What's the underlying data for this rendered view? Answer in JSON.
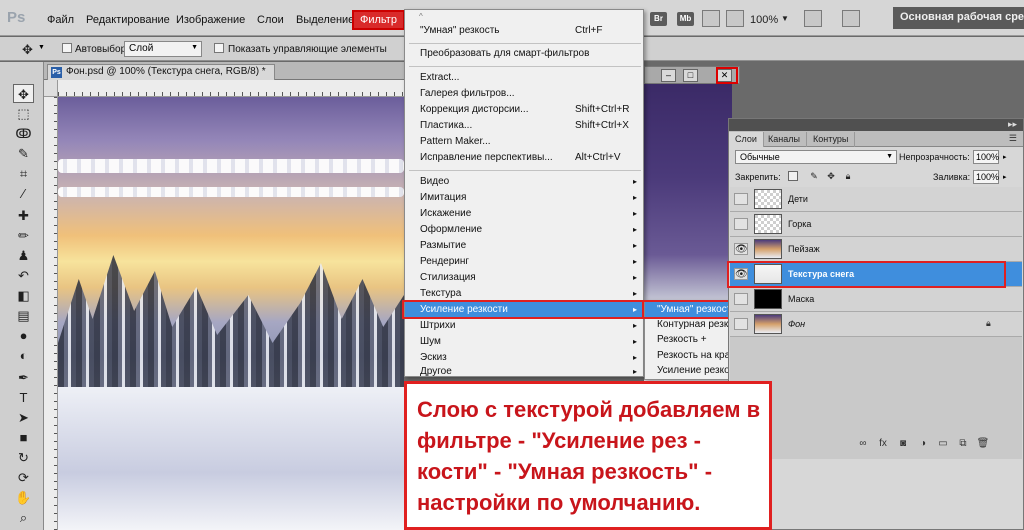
{
  "menubar": {
    "logo": "Ps",
    "items": [
      "Файл",
      "Редактирование",
      "Изображение",
      "Слои",
      "Выделение",
      "Фильтр"
    ],
    "app_icons": [
      "Br",
      "Mb"
    ],
    "zoom": "100%",
    "workspace": "Основная рабочая среда"
  },
  "options": {
    "autoselect_label": "Автовыбор:",
    "autoselect_value": "Слой",
    "show_controls_label": "Показать управляющие элементы"
  },
  "tools": [
    "move-icon",
    "marquee-icon",
    "lasso-icon",
    "quick-select-icon",
    "crop-icon",
    "eyedropper-icon",
    "healing-icon",
    "brush-icon",
    "stamp-icon",
    "history-brush-icon",
    "eraser-icon",
    "gradient-icon",
    "blur-icon",
    "dodge-icon",
    "pen-icon",
    "type-icon",
    "path-select-icon",
    "shape-icon",
    "3d-rotate-icon",
    "3d-camera-icon",
    "hand-icon",
    "zoom-icon"
  ],
  "document": {
    "tab_title": "Фон.psd @ 100% (Текстура снега, RGB/8) *",
    "tab_icon": "Ps"
  },
  "filter_menu": {
    "top_marker": "^",
    "last_filter": {
      "label": "\"Умная\" резкость",
      "shortcut": "Ctrl+F"
    },
    "smart_filters": "Преобразовать для смарт-фильтров",
    "group1": [
      {
        "label": "Extract...",
        "shortcut": ""
      },
      {
        "label": "Галерея фильтров...",
        "shortcut": ""
      },
      {
        "label": "Коррекция дисторсии...",
        "shortcut": "Shift+Ctrl+R"
      },
      {
        "label": "Пластика...",
        "shortcut": "Shift+Ctrl+X"
      },
      {
        "label": "Pattern Maker...",
        "shortcut": ""
      },
      {
        "label": "Исправление перспективы...",
        "shortcut": "Alt+Ctrl+V"
      }
    ],
    "group2": [
      "Видео",
      "Имитация",
      "Искажение",
      "Оформление",
      "Размытие",
      "Рендеринг",
      "Стилизация",
      "Текстура",
      "Усиление резкости",
      "Штрихи",
      "Шум",
      "Эскиз",
      "Другое"
    ],
    "submenu_arrow": "▸"
  },
  "sharpen_submenu": [
    "\"Умная\" резкость...",
    "Контурная резкость...",
    "Резкость +",
    "Резкость на краях",
    "Усиление резкости"
  ],
  "layers_panel": {
    "tabs": [
      "Слои",
      "Каналы",
      "Контуры"
    ],
    "blend_mode": "Обычные",
    "opacity_label": "Непрозрачность:",
    "opacity_value": "100%",
    "lock_label": "Закрепить:",
    "fill_label": "Заливка:",
    "fill_value": "100%",
    "layers": [
      {
        "name": "Дети",
        "visible": false
      },
      {
        "name": "Горка",
        "visible": false
      },
      {
        "name": "Пейзаж",
        "visible": true
      },
      {
        "name": "Текстура снега",
        "visible": true,
        "selected": true
      },
      {
        "name": "Маска",
        "visible": false
      },
      {
        "name": "Фон",
        "visible": false,
        "locked": true
      }
    ],
    "footer_icons": [
      "link-icon",
      "fx-icon",
      "mask-icon",
      "adjustment-icon",
      "group-icon",
      "new-layer-icon",
      "trash-icon"
    ],
    "fx_label": "fx"
  },
  "note": {
    "text": "Слою с текстурой добавляем в фильтре - \"Усиление рез - кости\" - \"Умная резкость\" - настройки по умолчанию."
  },
  "colors": {
    "highlight": "#3f8edd",
    "annotation_red": "#e02020",
    "note_text": "#c8151b"
  }
}
